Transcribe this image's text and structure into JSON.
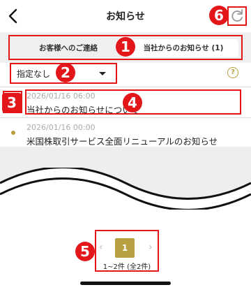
{
  "header": {
    "title": "お知らせ",
    "back_icon": "chevron-left-icon",
    "refresh_icon": "refresh-icon"
  },
  "tabs": [
    {
      "label": "お客様へのご連絡",
      "selected": false
    },
    {
      "label": "当社からのお知らせ (1)",
      "selected": true
    }
  ],
  "filter": {
    "value": "指定なし",
    "help_label": "?"
  },
  "news": [
    {
      "date": "2026/01/16 06:00",
      "title": "当社からのお知らせについて"
    },
    {
      "date": "2026/01/16 00:00",
      "title": "米国株取引サービス全面リニューアルのお知らせ"
    }
  ],
  "pagination": {
    "current": "1",
    "prev": "‹",
    "next": "›",
    "info": "1~2件 (全2件)"
  },
  "annotations": [
    "1",
    "2",
    "3",
    "4",
    "5",
    "6"
  ],
  "colors": {
    "accent": "#b8a040",
    "annotation_red": "#e3161a"
  }
}
